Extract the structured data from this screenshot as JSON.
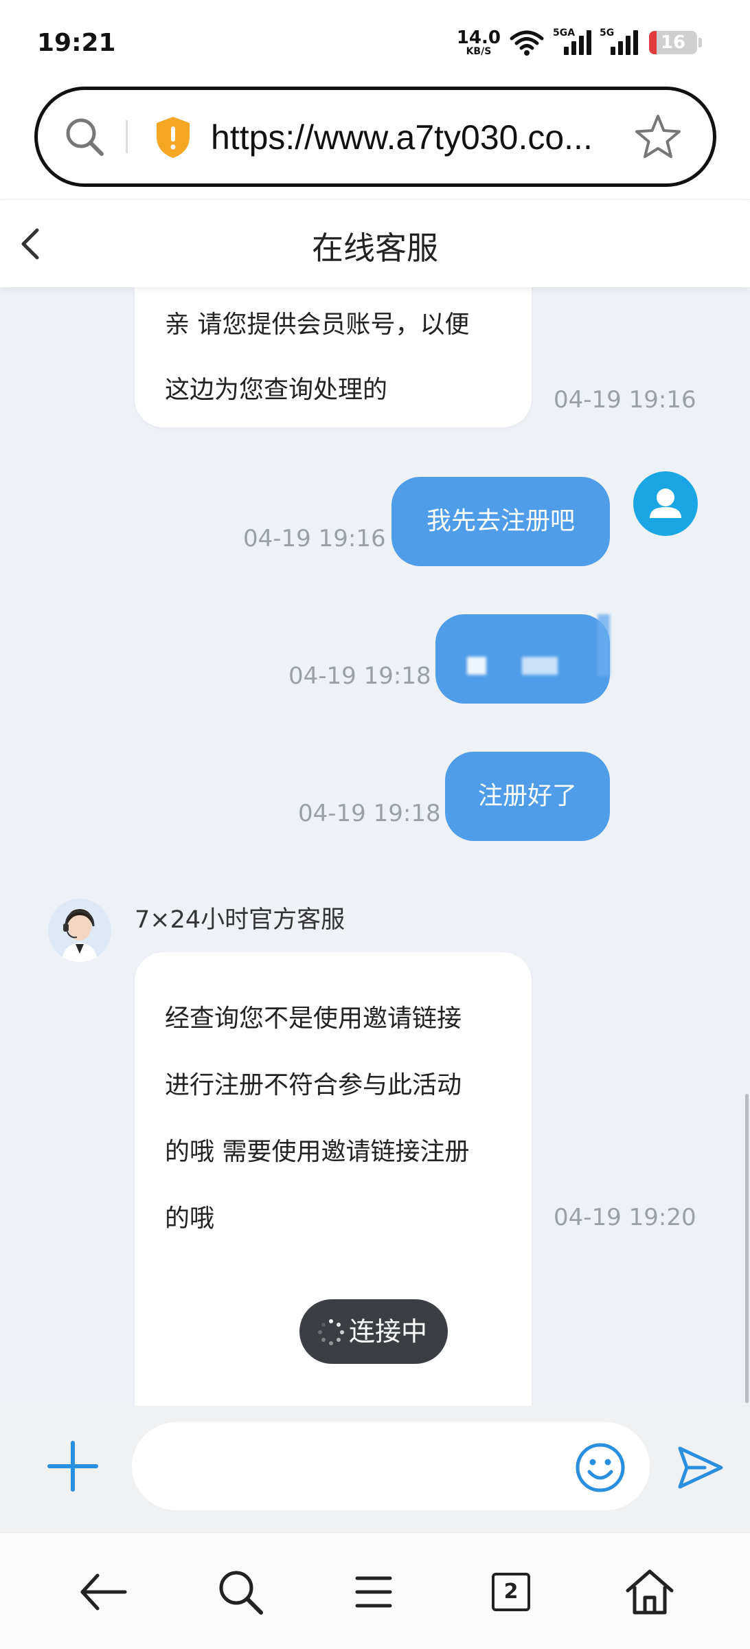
{
  "status_bar": {
    "time": "19:21",
    "net_speed_value": "14.0",
    "net_speed_unit": "KB/S",
    "sim1_label": "5GA",
    "sim2_label": "5G",
    "battery_level": "16",
    "battery_color": "#e23b3b"
  },
  "browser": {
    "url": "https://www.a7ty030.co...",
    "shield_color": "#f5a623",
    "open_tabs": "2"
  },
  "chat": {
    "title": "在线客服",
    "accent_color": "#4f9de8",
    "agent_name": "7×24小时官方客服",
    "messages": [
      {
        "from": "agent",
        "lines": [
          "亲 请您提供会员账号，以便",
          "这边为您查询处理的"
        ],
        "time": "04-19 19:16"
      },
      {
        "from": "user",
        "text": "我先去注册吧",
        "time": "04-19 19:16"
      },
      {
        "from": "user",
        "text": "",
        "time": "04-19 19:18"
      },
      {
        "from": "user",
        "text": "注册好了",
        "time": "04-19 19:18"
      },
      {
        "from": "agent",
        "lines": [
          "经查询您不是使用邀请链接",
          "进行注册不符合参与此活动",
          "的哦 需要使用邀请链接注册",
          "的哦"
        ],
        "time": "04-19 19:20"
      }
    ],
    "connecting_toast": "连接中"
  },
  "input": {
    "placeholder": "",
    "value": ""
  }
}
